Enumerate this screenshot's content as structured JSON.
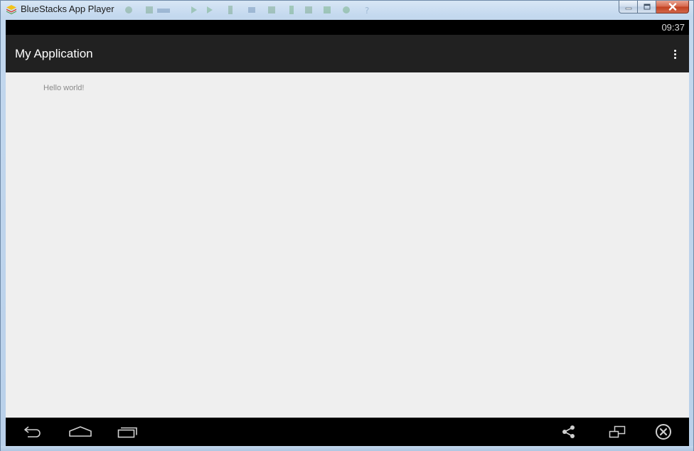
{
  "window": {
    "title": "BlueStacks App Player",
    "controls": {
      "minimize_icon": "minimize-icon",
      "maximize_icon": "maximize-icon",
      "close_icon": "close-icon"
    }
  },
  "status_bar": {
    "time": "09:37"
  },
  "action_bar": {
    "title": "My Application",
    "overflow_icon": "more-vert-icon"
  },
  "content": {
    "text": "Hello world!"
  },
  "nav_bar": {
    "buttons": [
      {
        "name": "back",
        "icon": "back-icon"
      },
      {
        "name": "home",
        "icon": "home-icon"
      },
      {
        "name": "recent-apps",
        "icon": "recent-apps-icon"
      },
      {
        "name": "share",
        "icon": "share-icon"
      },
      {
        "name": "rotate",
        "icon": "rotate-screen-icon"
      },
      {
        "name": "close-app",
        "icon": "close-circle-icon"
      }
    ]
  },
  "colors": {
    "status_bar": "#000000",
    "action_bar": "#212121",
    "content_bg": "#efefef",
    "nav_bar": "#000000",
    "hello_text": "#8a8a8a"
  }
}
